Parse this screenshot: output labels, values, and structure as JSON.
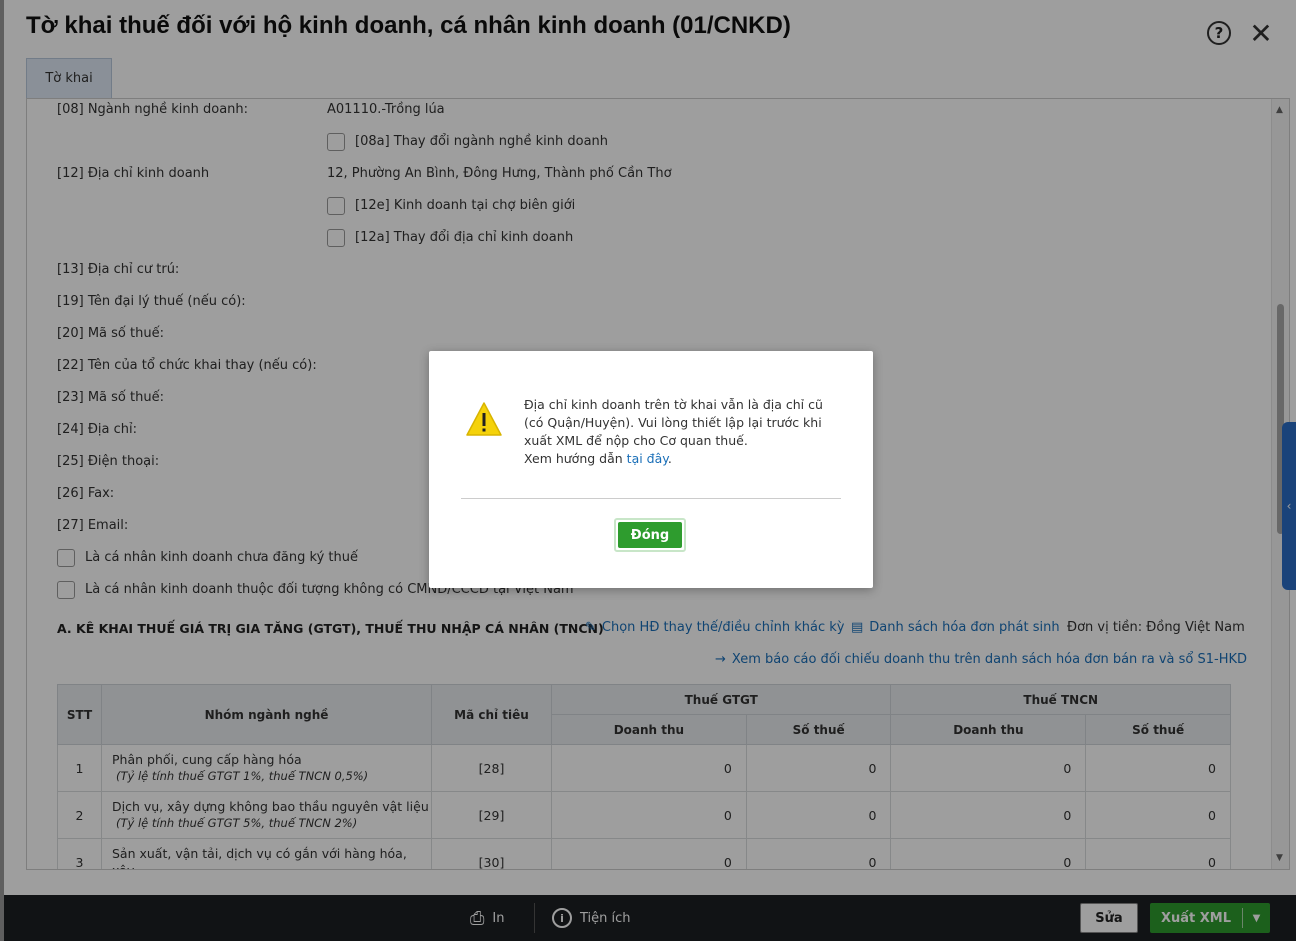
{
  "window": {
    "title": "Tờ khai thuế đối với hộ kinh doanh, cá nhân kinh doanh (01/CNKD)"
  },
  "tab": {
    "label": "Tờ khai"
  },
  "form": {
    "f08_label": "[08] Ngành nghề kinh doanh:",
    "f08_value": "A01110.-Trồng lúa",
    "f08a_label": "[08a] Thay đổi ngành nghề kinh doanh",
    "f12_label": "[12] Địa chỉ kinh doanh",
    "f12_value": "12, Phường An Bình, Đông Hưng, Thành phố Cần Thơ",
    "f12e_label": "[12e] Kinh doanh tại chợ biên giới",
    "f12a_label": "[12a] Thay đổi địa chỉ kinh doanh",
    "f13_label": "[13] Địa chỉ cư trú:",
    "f19_label": "[19] Tên đại lý thuế (nếu có):",
    "f20_label": "[20] Mã số thuế:",
    "f22_label": "[22] Tên của tổ chức khai thay (nếu có):",
    "f23_label": "[23] Mã số thuế:",
    "f24_label": "[24] Địa chỉ:",
    "f25_label": "[25] Điện thoại:",
    "f26_label": "[26] Fax:",
    "f27_label": "[27] Email:",
    "cb1_label": "Là cá nhân kinh doanh chưa đăng ký thuế",
    "cb2_label": "Là cá nhân kinh doanh thuộc đối tượng không có CMND/CCCD tại Việt Nam"
  },
  "section_a": {
    "title": "A. KÊ KHAI THUẾ GIÁ TRỊ GIA TĂNG (GTGT), THUẾ THU NHẬP CÁ NHÂN (TNCN)",
    "link_choose": "Chọn HĐ thay thế/điều chỉnh khác kỳ",
    "link_invoices": "Danh sách hóa đơn phát sinh",
    "currency": "Đơn vị tiền: Đồng Việt Nam",
    "link_report": "Xem báo cáo đối chiếu doanh thu trên danh sách hóa đơn bán ra và sổ S1-HKD"
  },
  "table": {
    "h_stt": "STT",
    "h_group": "Nhóm ngành nghề",
    "h_code": "Mã chỉ tiêu",
    "h_vat": "Thuế GTGT",
    "h_pit": "Thuế TNCN",
    "h_revenue": "Doanh thu",
    "h_tax": "Số thuế",
    "rows": [
      {
        "stt": "1",
        "name": "Phân phối, cung cấp hàng hóa",
        "note": "(Tỷ lệ tính thuế GTGT 1%, thuế TNCN 0,5%)",
        "code": "[28]",
        "vat_rev": "0",
        "vat_tax": "0",
        "pit_rev": "0",
        "pit_tax": "0"
      },
      {
        "stt": "2",
        "name": "Dịch vụ, xây dựng không bao thầu nguyên vật liệu",
        "note": "(Tỷ lệ tính thuế GTGT 5%, thuế TNCN 2%)",
        "code": "[29]",
        "vat_rev": "0",
        "vat_tax": "0",
        "pit_rev": "0",
        "pit_tax": "0"
      },
      {
        "stt": "3",
        "name": "Sản xuất, vận tải, dịch vụ có gắn với hàng hóa, xây",
        "note": "",
        "code": "[30]",
        "vat_rev": "0",
        "vat_tax": "0",
        "pit_rev": "0",
        "pit_tax": "0"
      }
    ]
  },
  "footer": {
    "print": "In",
    "utilities": "Tiện ích",
    "edit": "Sửa",
    "export_xml": "Xuất XML"
  },
  "modal": {
    "message": "Địa chỉ kinh doanh trên tờ khai vẫn là địa chỉ cũ (có Quận/Huyện). Vui lòng thiết lập lại trước khi xuất XML để nộp cho Cơ quan thuế.",
    "guide_prefix": "Xem hướng dẫn",
    "guide_link": "tại đây",
    "guide_suffix": ".",
    "close_label": "Đóng"
  },
  "colors": {
    "accent_green": "#2e9c2e",
    "link_blue": "#1a6fb8",
    "side_tab_blue": "#2a6dc6"
  }
}
